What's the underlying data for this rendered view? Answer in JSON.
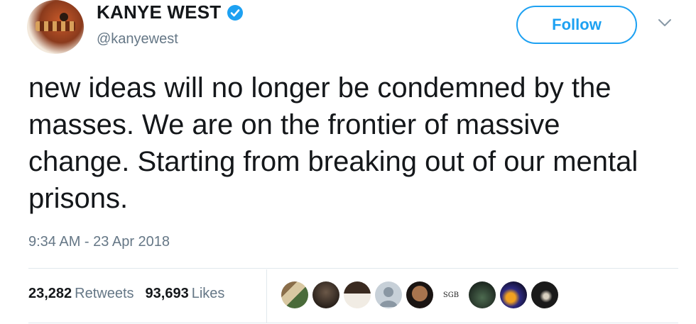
{
  "user": {
    "display_name": "KANYE WEST",
    "handle": "@kanyewest",
    "verified": true
  },
  "follow_button": {
    "label": "Follow"
  },
  "tweet": {
    "text": "new ideas will no longer be condemned by the masses. We are on the frontier of massive change. Starting from breaking out of our mental prisons.",
    "timestamp": "9:34 AM - 23 Apr 2018"
  },
  "stats": {
    "retweets_count": "23,282",
    "retweets_label": "Retweets",
    "likes_count": "93,693",
    "likes_label": "Likes"
  },
  "likers": [
    {
      "id": "liker-1"
    },
    {
      "id": "liker-2"
    },
    {
      "id": "liker-3"
    },
    {
      "id": "liker-4",
      "icon": "default-avatar-icon"
    },
    {
      "id": "liker-5"
    },
    {
      "id": "liker-6",
      "text": "SGB"
    },
    {
      "id": "liker-7"
    },
    {
      "id": "liker-8"
    },
    {
      "id": "liker-9"
    }
  ],
  "colors": {
    "accent": "#1da1f2",
    "secondary_text": "#657786",
    "primary_text": "#14171a",
    "divider": "#e1e8ed"
  }
}
